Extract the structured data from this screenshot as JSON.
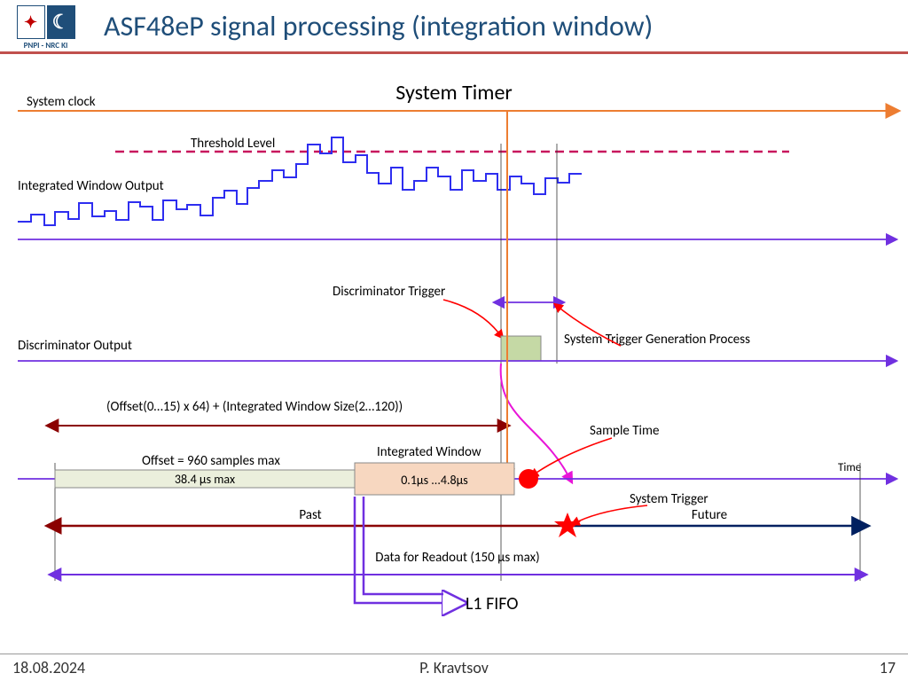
{
  "header": {
    "logo_caption": "PNPI - NRC KI",
    "title": "ASF48eP signal processing (integration window)"
  },
  "labels": {
    "system_timer": "System Timer",
    "system_clock": "System clock",
    "threshold_level": "Threshold Level",
    "integrated_window_output": "Integrated Window Output",
    "discriminator_trigger": "Discriminator Trigger",
    "discriminator_output": "Discriminator Output",
    "sys_trigger_gen": "System Trigger Generation Process",
    "offset_formula": "(Offset(0…15) x 64) + (Integrated Window Size(2…120))",
    "offset_max": "Offset = 960 samples max",
    "offset_time": "38.4 µs max",
    "integrated_window": "Integrated Window",
    "int_win_time": "0.1µs ...4.8µs",
    "sample_time": "Sample Time",
    "time": "Time",
    "past": "Past",
    "future": "Future",
    "system_trigger": "System Trigger",
    "data_readout": "Data for Readout (150 µs max)",
    "l1_fifo": "L1 FIFO"
  },
  "footer": {
    "date": "18.08.2024",
    "author": "P. Kravtsov",
    "page": "17"
  },
  "colors": {
    "title": "#1f4e79",
    "orange": "#ed7d31",
    "crimson": "#c8175d",
    "blue": "#2e2ef0",
    "purple": "#7030e0",
    "darkred": "#8b0000",
    "navy": "#002060",
    "magenta": "#e815d8",
    "red": "#ff0000"
  }
}
